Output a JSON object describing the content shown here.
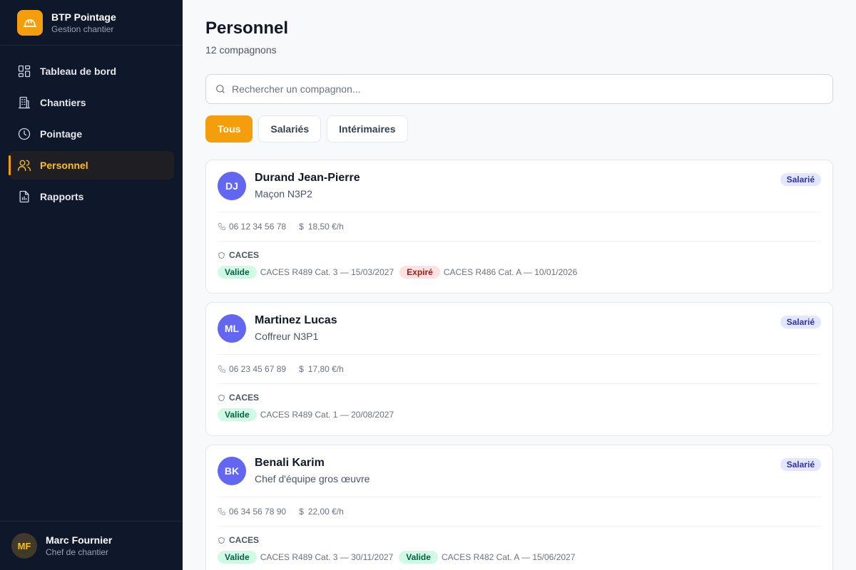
{
  "brand": {
    "title": "BTP Pointage",
    "subtitle": "Gestion chantier"
  },
  "nav": [
    {
      "label": "Tableau de bord",
      "icon": "dashboard-icon"
    },
    {
      "label": "Chantiers",
      "icon": "building-icon"
    },
    {
      "label": "Pointage",
      "icon": "clock-icon"
    },
    {
      "label": "Personnel",
      "icon": "users-icon",
      "active": true
    },
    {
      "label": "Rapports",
      "icon": "report-icon"
    }
  ],
  "user": {
    "initials": "MF",
    "name": "Marc Fournier",
    "role": "Chef de chantier"
  },
  "page": {
    "title": "Personnel",
    "subtitle": "12 compagnons"
  },
  "search": {
    "placeholder": "Rechercher un compagnon..."
  },
  "filters": [
    {
      "label": "Tous",
      "active": true
    },
    {
      "label": "Salariés"
    },
    {
      "label": "Intérimaires"
    }
  ],
  "caces_label": "CACES",
  "workers": [
    {
      "initials": "DJ",
      "name": "Durand Jean-Pierre",
      "role": "Maçon N3P2",
      "type": "Salarié",
      "phone": "06 12 34 56 78",
      "rate": "18,50 €/h",
      "certs": [
        {
          "status": "Valide",
          "ok": true,
          "text": "CACES R489 Cat. 3 — 15/03/2027"
        },
        {
          "status": "Expiré",
          "ok": false,
          "text": "CACES R486 Cat. A — 10/01/2026"
        }
      ]
    },
    {
      "initials": "ML",
      "name": "Martinez Lucas",
      "role": "Coffreur N3P1",
      "type": "Salarié",
      "phone": "06 23 45 67 89",
      "rate": "17,80 €/h",
      "certs": [
        {
          "status": "Valide",
          "ok": true,
          "text": "CACES R489 Cat. 1 — 20/08/2027"
        }
      ]
    },
    {
      "initials": "BK",
      "name": "Benali Karim",
      "role": "Chef d'équipe gros œuvre",
      "type": "Salarié",
      "phone": "06 34 56 78 90",
      "rate": "22,00 €/h",
      "certs": [
        {
          "status": "Valide",
          "ok": true,
          "text": "CACES R489 Cat. 3 — 30/11/2027"
        },
        {
          "status": "Valide",
          "ok": true,
          "text": "CACES R482 Cat. A — 15/06/2027"
        }
      ]
    }
  ],
  "colors": {
    "accent": "#f59e0b",
    "sidebar": "#0f172a",
    "avatar": "#6366f1"
  }
}
